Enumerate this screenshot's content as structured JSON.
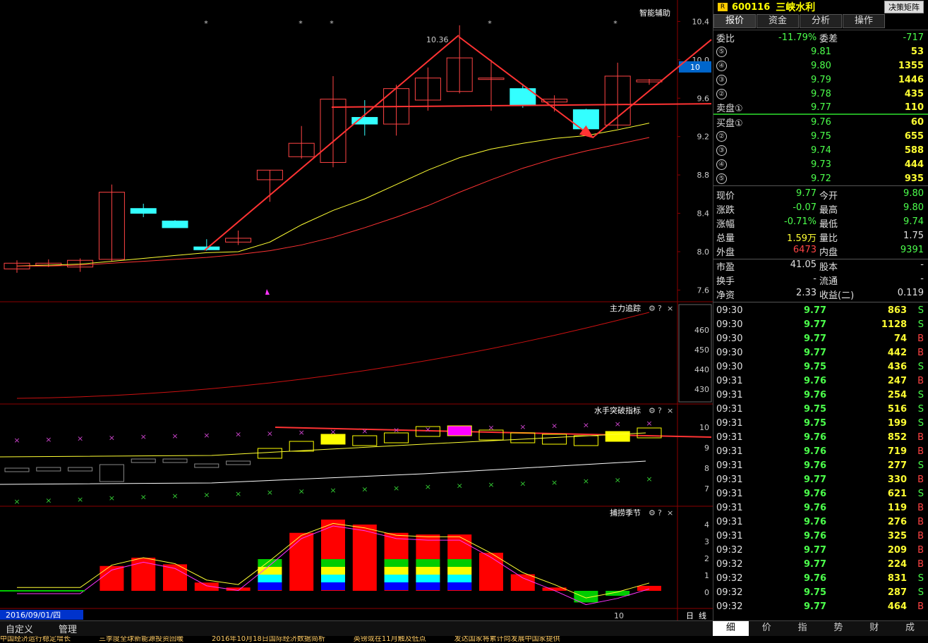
{
  "header": {
    "code": "600116",
    "name": "三峡水利",
    "decision_button": "决策矩阵",
    "assist_label": "智能辅助",
    "logo_glyph": "R"
  },
  "tabs": [
    "报价",
    "资金",
    "分析",
    "操作"
  ],
  "order_book": {
    "weibi_label": "委比",
    "weibi_value": "-11.79%",
    "weicha_label": "委差",
    "weicha_value": "-717",
    "asks": [
      {
        "level": "⑤",
        "price": "9.81",
        "vol": "53"
      },
      {
        "level": "④",
        "price": "9.80",
        "vol": "1355"
      },
      {
        "level": "③",
        "price": "9.79",
        "vol": "1446"
      },
      {
        "level": "②",
        "price": "9.78",
        "vol": "435"
      },
      {
        "level": "卖盘①",
        "price": "9.77",
        "vol": "110"
      }
    ],
    "bids": [
      {
        "level": "买盘①",
        "price": "9.76",
        "vol": "60"
      },
      {
        "level": "②",
        "price": "9.75",
        "vol": "655"
      },
      {
        "level": "③",
        "price": "9.74",
        "vol": "588"
      },
      {
        "level": "④",
        "price": "9.73",
        "vol": "444"
      },
      {
        "level": "⑤",
        "price": "9.72",
        "vol": "935"
      }
    ]
  },
  "stats": [
    {
      "l1": "现价",
      "v1": "9.77",
      "c1": "green",
      "l2": "今开",
      "v2": "9.80",
      "c2": "green"
    },
    {
      "l1": "涨跌",
      "v1": "-0.07",
      "c1": "green",
      "l2": "最高",
      "v2": "9.80",
      "c2": "green"
    },
    {
      "l1": "涨幅",
      "v1": "-0.71%",
      "c1": "green",
      "l2": "最低",
      "v2": "9.74",
      "c2": "green"
    },
    {
      "l1": "总量",
      "v1": "1.59万",
      "c1": "yellow",
      "l2": "量比",
      "v2": "1.75",
      "c2": "white"
    },
    {
      "l1": "外盘",
      "v1": "6473",
      "c1": "red",
      "l2": "内盘",
      "v2": "9391",
      "c2": "green"
    }
  ],
  "stats2": [
    {
      "l1": "市盈",
      "v1": "41.05",
      "l2": "股本",
      "v2": "-"
    },
    {
      "l1": "换手",
      "v1": "-",
      "l2": "流通",
      "v2": "-"
    },
    {
      "l1": "净资",
      "v1": "2.33",
      "l2": "收益(二)",
      "v2": "0.119"
    }
  ],
  "ticks": [
    {
      "t": "09:30",
      "p": "9.77",
      "v": "863",
      "s": "S"
    },
    {
      "t": "09:30",
      "p": "9.77",
      "v": "1128",
      "s": "S"
    },
    {
      "t": "09:30",
      "p": "9.77",
      "v": "74",
      "s": "B"
    },
    {
      "t": "09:30",
      "p": "9.77",
      "v": "442",
      "s": "B"
    },
    {
      "t": "09:30",
      "p": "9.75",
      "v": "436",
      "s": "S"
    },
    {
      "t": "09:31",
      "p": "9.76",
      "v": "247",
      "s": "B"
    },
    {
      "t": "09:31",
      "p": "9.76",
      "v": "254",
      "s": "S"
    },
    {
      "t": "09:31",
      "p": "9.75",
      "v": "516",
      "s": "S"
    },
    {
      "t": "09:31",
      "p": "9.75",
      "v": "199",
      "s": "S"
    },
    {
      "t": "09:31",
      "p": "9.76",
      "v": "852",
      "s": "B"
    },
    {
      "t": "09:31",
      "p": "9.76",
      "v": "719",
      "s": "B"
    },
    {
      "t": "09:31",
      "p": "9.76",
      "v": "277",
      "s": "S"
    },
    {
      "t": "09:31",
      "p": "9.77",
      "v": "330",
      "s": "B"
    },
    {
      "t": "09:31",
      "p": "9.76",
      "v": "621",
      "s": "S"
    },
    {
      "t": "09:31",
      "p": "9.76",
      "v": "119",
      "s": "B"
    },
    {
      "t": "09:31",
      "p": "9.76",
      "v": "276",
      "s": "B"
    },
    {
      "t": "09:31",
      "p": "9.76",
      "v": "325",
      "s": "B"
    },
    {
      "t": "09:32",
      "p": "9.77",
      "v": "209",
      "s": "B"
    },
    {
      "t": "09:32",
      "p": "9.77",
      "v": "224",
      "s": "B"
    },
    {
      "t": "09:32",
      "p": "9.76",
      "v": "831",
      "s": "S"
    },
    {
      "t": "09:32",
      "p": "9.75",
      "v": "287",
      "s": "S"
    },
    {
      "t": "09:32",
      "p": "9.77",
      "v": "464",
      "s": "B"
    }
  ],
  "bottom_tabs": [
    "细",
    "价",
    "指",
    "势",
    "财",
    "成"
  ],
  "bottom_bar": {
    "custom": "自定义",
    "manage": "管理",
    "date": "2016/09/01/四",
    "cursor_val": "10",
    "period_a": "日",
    "period_b": "线"
  },
  "ticker": [
    "中国经济运行稳定增长",
    "三季度全球新能源投资回暖",
    "2016年10月18日国际经济数据简析",
    "英镑或在11月触及低点",
    "发达国家将累计向发展中国家提供"
  ],
  "indicators": {
    "main": {
      "title": "智能辅助",
      "peak_label": "10.36",
      "current_tag": "10",
      "yticks": [
        "10.4",
        "10.0",
        "9.6",
        "9.2",
        "8.8",
        "8.4",
        "8.0",
        "7.6"
      ]
    },
    "p1": {
      "title": "主力追踪",
      "yticks": [
        "460",
        "450",
        "440",
        "430"
      ]
    },
    "p2": {
      "title": "水手突破指标",
      "yticks": [
        "10",
        "9",
        "8",
        "7"
      ]
    },
    "p3": {
      "title": "捕捞季节",
      "yticks": [
        "4",
        "3",
        "2",
        "1",
        "0"
      ]
    }
  },
  "candles": [
    {
      "o": 7.82,
      "c": 7.88,
      "h": 7.91,
      "l": 7.78
    },
    {
      "o": 7.86,
      "c": 7.88,
      "h": 7.92,
      "l": 7.84
    },
    {
      "o": 7.84,
      "c": 7.91,
      "h": 7.93,
      "l": 7.79
    },
    {
      "o": 7.92,
      "c": 8.62,
      "h": 8.7,
      "l": 7.9
    },
    {
      "o": 8.45,
      "c": 8.4,
      "h": 8.5,
      "l": 8.36
    },
    {
      "o": 8.32,
      "c": 8.25,
      "h": 8.33,
      "l": 8.25
    },
    {
      "o": 8.05,
      "c": 8.02,
      "h": 8.13,
      "l": 8.01
    },
    {
      "o": 8.1,
      "c": 8.14,
      "h": 8.22,
      "l": 8.07
    },
    {
      "o": 8.75,
      "c": 8.85,
      "h": 8.85,
      "l": 8.52
    },
    {
      "o": 8.99,
      "c": 9.13,
      "h": 9.31,
      "l": 8.97
    },
    {
      "o": 8.93,
      "c": 9.59,
      "h": 9.83,
      "l": 8.88
    },
    {
      "o": 9.4,
      "c": 9.33,
      "h": 9.58,
      "l": 9.21
    },
    {
      "o": 9.33,
      "c": 9.7,
      "h": 9.74,
      "l": 9.21
    },
    {
      "o": 9.58,
      "c": 9.81,
      "h": 9.92,
      "l": 9.47
    },
    {
      "o": 9.67,
      "c": 10.02,
      "h": 10.36,
      "l": 9.65
    },
    {
      "o": 9.81,
      "c": 9.81,
      "h": 10.0,
      "l": 9.47
    },
    {
      "o": 9.7,
      "c": 9.53,
      "h": 9.75,
      "l": 9.5
    },
    {
      "o": 9.56,
      "c": 9.59,
      "h": 9.63,
      "l": 9.46
    },
    {
      "o": 9.48,
      "c": 9.28,
      "h": 9.49,
      "l": 9.26
    },
    {
      "o": 9.32,
      "c": 9.83,
      "h": 9.97,
      "l": 9.28
    },
    {
      "o": 9.77,
      "c": 9.79,
      "h": 9.8,
      "l": 9.74
    }
  ],
  "colors": {
    "up": "#ff4444",
    "down": "#33ffff",
    "ma1": "#ffff33",
    "ma2": "#ff3333",
    "grid": "#3a0000",
    "arrow": "#ff3333"
  }
}
